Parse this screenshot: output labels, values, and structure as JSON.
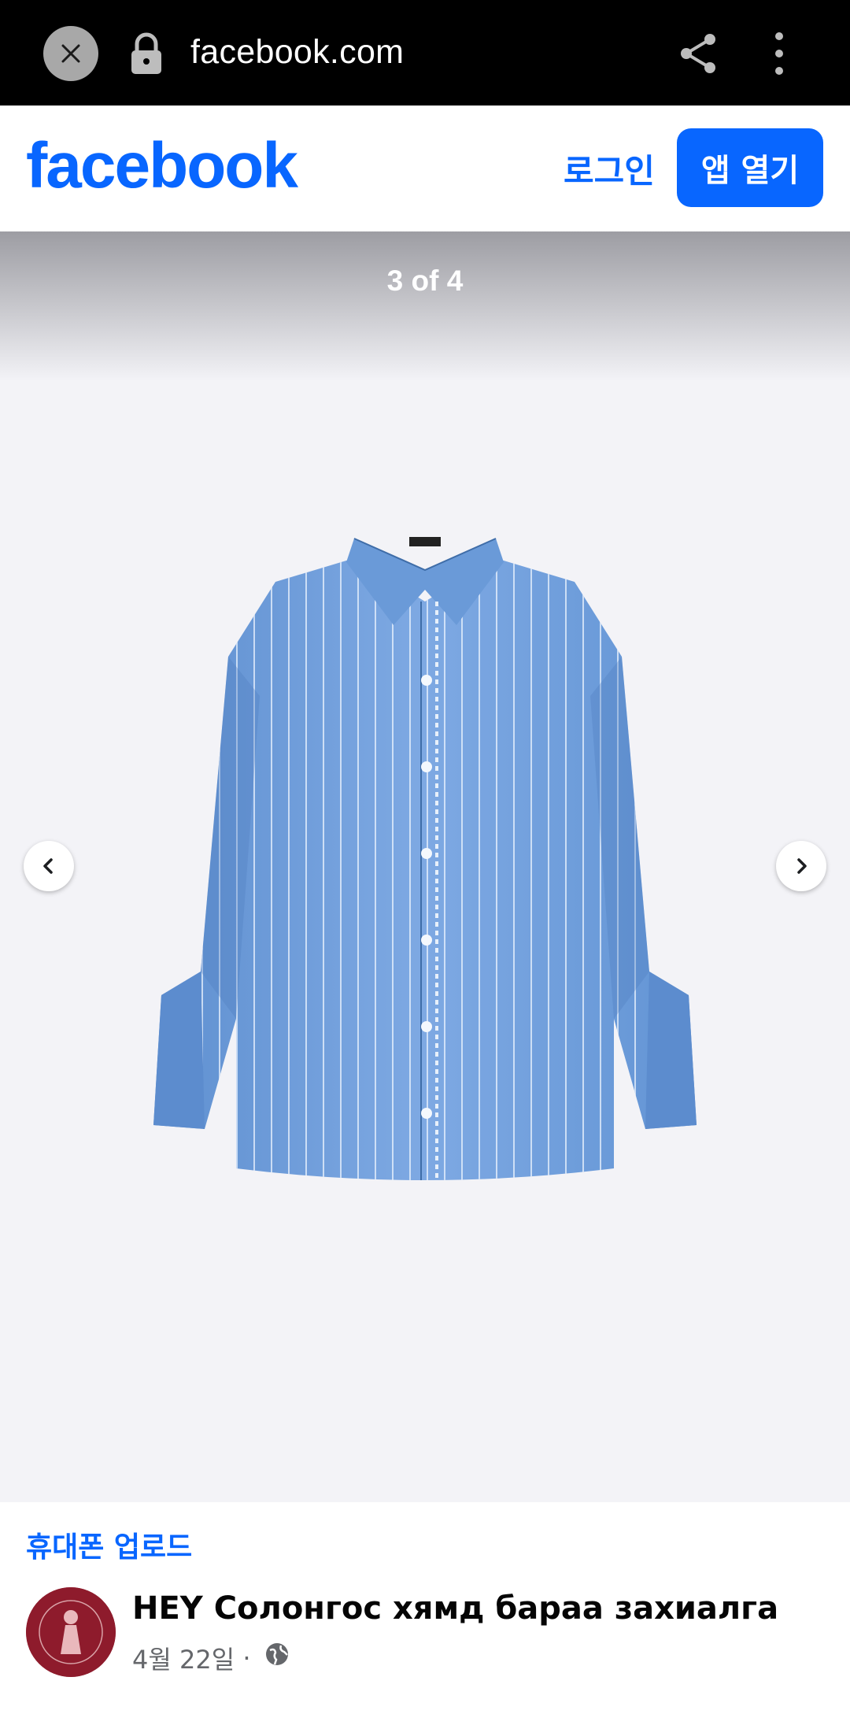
{
  "browser": {
    "url": "facebook.com"
  },
  "header": {
    "logo": "facebook",
    "login_label": "로그인",
    "open_app_label": "앱 열기",
    "brand_color": "#0866ff"
  },
  "viewer": {
    "counter": "3 of 4"
  },
  "post": {
    "album": "휴대폰 업로드",
    "page_name": "HEY Солонгос хямд бараа захиалга",
    "date": "4월 22일",
    "separator": " · "
  },
  "icons": [
    "close-icon",
    "lock-icon",
    "share-icon",
    "more-icon",
    "chevron-left-icon",
    "chevron-right-icon",
    "globe-icon"
  ]
}
